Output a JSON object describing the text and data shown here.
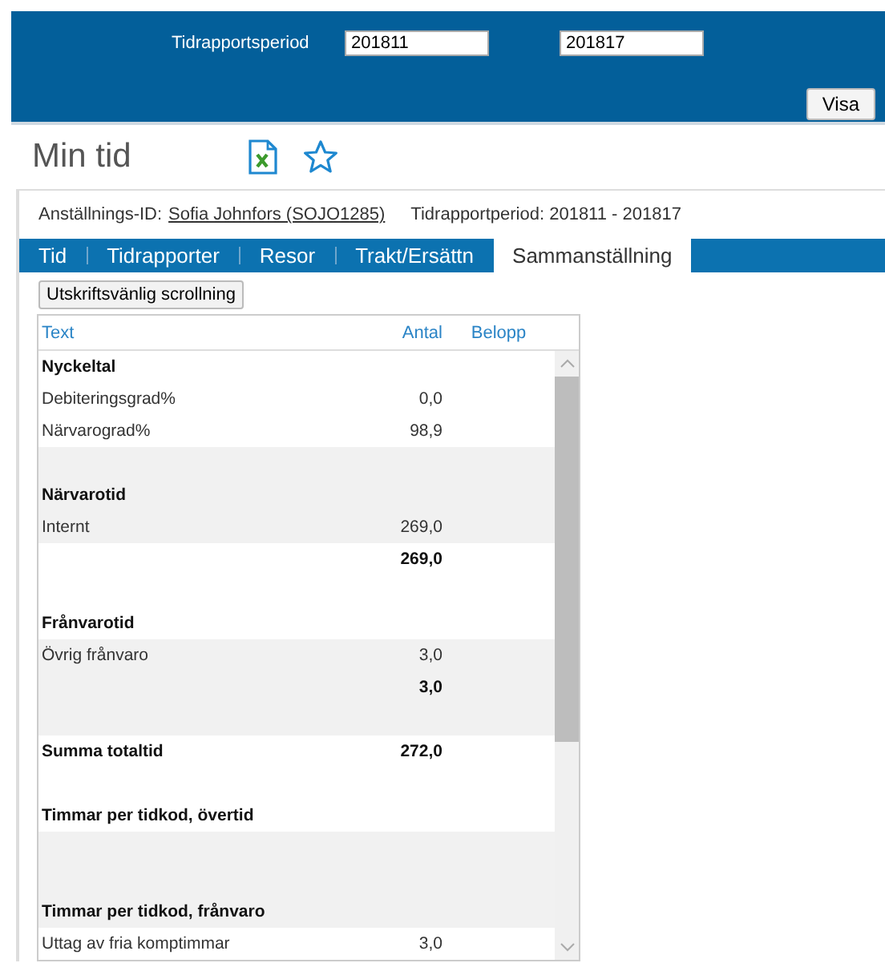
{
  "header": {
    "period_label": "Tidrapportsperiod",
    "period_from": "201811",
    "period_to": "201817",
    "show_button": "Visa"
  },
  "page_title": "Min tid",
  "info": {
    "employee_label": "Anställnings-ID:",
    "employee_link": "Sofia Johnfors (SOJO1285)",
    "period_text": "Tidrapportperiod: 201811 - 201817"
  },
  "tabs": [
    {
      "label": "Tid",
      "selected": false
    },
    {
      "label": "Tidrapporter",
      "selected": false
    },
    {
      "label": "Resor",
      "selected": false
    },
    {
      "label": "Trakt/Ersättn",
      "selected": false
    },
    {
      "label": "Sammanställning",
      "selected": true
    }
  ],
  "print_button": "Utskriftsvänlig scrollning",
  "table": {
    "columns": [
      "Text",
      "Antal",
      "Belopp"
    ],
    "rows": [
      {
        "kind": "heading",
        "text": "Nyckeltal"
      },
      {
        "kind": "item",
        "text": "Debiteringsgrad%",
        "antal": "0,0"
      },
      {
        "kind": "item",
        "text": "Närvarograd%",
        "antal": "98,9"
      },
      {
        "kind": "blank"
      },
      {
        "kind": "heading",
        "text": "Närvarotid"
      },
      {
        "kind": "item",
        "text": "Internt",
        "antal": "269,0"
      },
      {
        "kind": "total",
        "antal": "269,0"
      },
      {
        "kind": "blank"
      },
      {
        "kind": "heading",
        "text": "Frånvarotid"
      },
      {
        "kind": "item",
        "text": "Övrig frånvaro",
        "antal": "3,0"
      },
      {
        "kind": "total",
        "antal": "3,0"
      },
      {
        "kind": "blank"
      },
      {
        "kind": "heading",
        "text": "Summa totaltid",
        "antal": "272,0"
      },
      {
        "kind": "blank"
      },
      {
        "kind": "heading",
        "text": "Timmar per tidkod, övertid"
      },
      {
        "kind": "blank"
      },
      {
        "kind": "blank"
      },
      {
        "kind": "heading",
        "text": "Timmar per tidkod, frånvaro"
      },
      {
        "kind": "item",
        "text": "Uttag av fria komptimmar",
        "antal": "3,0"
      }
    ]
  }
}
